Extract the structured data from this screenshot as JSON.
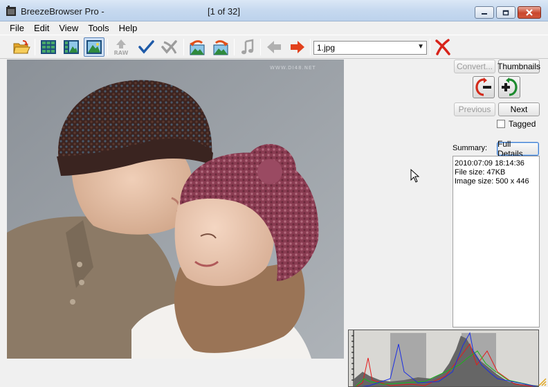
{
  "window": {
    "title": "BreezeBrowser Pro -",
    "counter": "[1 of 32]",
    "controls": [
      "minimize-icon",
      "maximize-icon",
      "close-icon"
    ]
  },
  "menu": {
    "items": [
      "File",
      "Edit",
      "View",
      "Tools",
      "Help"
    ]
  },
  "toolbar": {
    "file_select": {
      "value": "1.jpg"
    },
    "raw_label": "RAW",
    "icons": [
      "open-folder-icon",
      "thumbnail-grid-icon",
      "thumbnail-preview-icon",
      "full-image-icon",
      "raw-icon",
      "tag-checkmark-icon",
      "untag-icon",
      "rotate-left-icon",
      "rotate-right-icon",
      "music-note-icon",
      "back-arrow-icon",
      "forward-arrow-icon",
      "delete-icon"
    ]
  },
  "side_panel": {
    "convert_label": "Convert...",
    "thumbnails_label": "Thumbnails",
    "previous_label": "Previous",
    "next_label": "Next",
    "tagged_label": "Tagged",
    "summary_label": "Summary:",
    "full_details_label": "Full Details",
    "summary": {
      "date": "2010:07:09 18:14:36",
      "file_size": "File size: 47KB",
      "image_size": "Image size: 500 x 446"
    }
  },
  "photo": {
    "watermark": "WWW.DI48.NET"
  },
  "colors": {
    "titlebar": "#c6d9ef",
    "close_button": "#c9462c",
    "accent_blue": "#3d7bd0",
    "histogram_red": "#e41b1b",
    "histogram_green": "#18b818",
    "histogram_blue": "#1b2ee4"
  }
}
